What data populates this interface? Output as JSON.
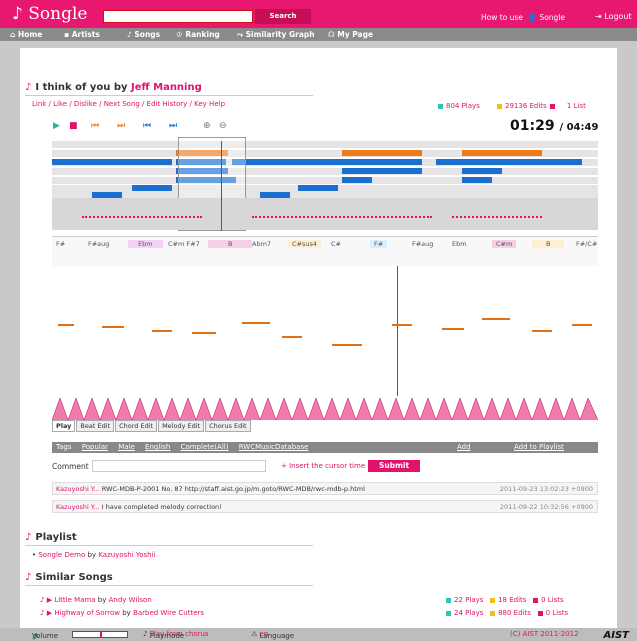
{
  "header": {
    "logo": "Songle",
    "search_button": "Search",
    "howto": "How to use",
    "songle": "Songle",
    "logout": "Logout"
  },
  "nav": [
    "Home",
    "Artists",
    "Songs",
    "Ranking",
    "Similarity Graph",
    "My Page"
  ],
  "song": {
    "title": "I think of you by",
    "artist": "Jeff Manning",
    "links": "Link / Like / Dislike / Next Song / Edit History / Key Help",
    "plays": "804 Plays",
    "edits": "29136 Edits",
    "lists": "1 List",
    "time_current": "01:29",
    "time_total": "/ 04:49"
  },
  "chords": [
    "F#",
    "F#aug",
    "Ebm",
    "C#m F#7",
    "B",
    "Abm7",
    "C#sus4",
    "C#",
    "F#",
    "F#aug",
    "Ebm",
    "C#m",
    "B",
    "F#/C#"
  ],
  "tabs": [
    "Play",
    "Beat Edit",
    "Chord Edit",
    "Melody Edit",
    "Chorus Edit"
  ],
  "tags": {
    "label": "Tags",
    "items": [
      "Popular",
      "Male",
      "English",
      "Complete(All)",
      "RWCMusicDatabase"
    ],
    "add": "Add",
    "add_playlist": "Add to Playlist"
  },
  "comment": {
    "label": "Comment",
    "insert": "Insert the cursor time",
    "submit": "Submit"
  },
  "comments": [
    {
      "user": "Kazuyoshi Y...",
      "text": "RWC-MDB-P-2001 No. 87 http://staff.aist.go.jp/m.goto/RWC-MDB/rwc-mdb-p.html",
      "date": "2011-09-23 13:02:23 +0900"
    },
    {
      "user": "Kazuyoshi Y...",
      "text": "I have completed melody correction!",
      "date": "2011-09-22 10:32:56 +0900"
    }
  ],
  "playlist": {
    "title": "Playlist",
    "item": "Songle Demo",
    "by": "by",
    "owner": "Kazuyoshi Yoshii"
  },
  "similar": {
    "title": "Similar Songs",
    "items": [
      {
        "text": "Little Mama",
        "by": "by",
        "artist": "Andy Wilson",
        "plays": "22 Plays",
        "edits": "18 Edits",
        "lists": "0 Lists"
      },
      {
        "text": "Highway of Sorrow",
        "by": "by",
        "artist": "Barbed Wire Cutters",
        "plays": "24 Plays",
        "edits": "880 Edits",
        "lists": "0 Lists"
      }
    ]
  },
  "footer": {
    "volume": "Volume",
    "playmode": "Playmode",
    "playmode_value": "Play from chorus",
    "language": "Language",
    "language_value": "en",
    "copyright": "(C) AIST 2011-2012",
    "aist": "AIST"
  }
}
